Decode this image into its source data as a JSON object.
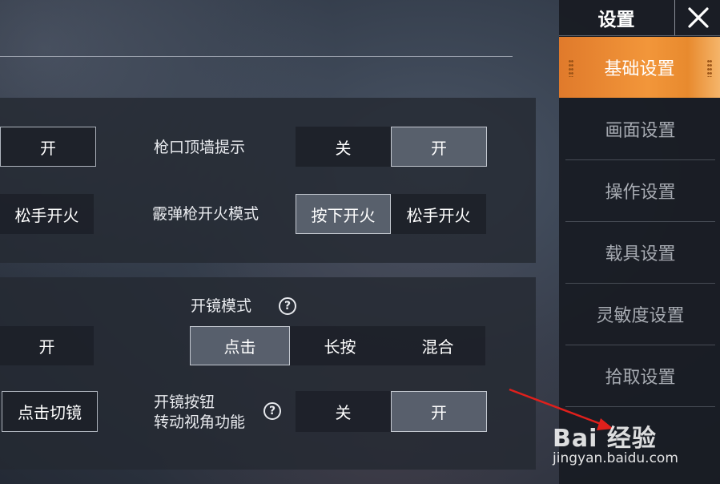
{
  "sidebar": {
    "title": "设置",
    "close_icon": "close-icon",
    "items": [
      {
        "label": "基础设置",
        "active": true
      },
      {
        "label": "画面设置"
      },
      {
        "label": "操作设置"
      },
      {
        "label": "载具设置"
      },
      {
        "label": "灵敏度设置"
      },
      {
        "label": "拾取设置"
      }
    ]
  },
  "section1": {
    "row1": {
      "left_option": "开",
      "label": "枪口顶墙提示",
      "options": [
        "关",
        "开"
      ],
      "selected": "开"
    },
    "row2": {
      "left_option": "松手开火",
      "label": "霰弹枪开火模式",
      "options": [
        "按下开火",
        "松手开火"
      ],
      "selected": "按下开火"
    }
  },
  "section2": {
    "scope_mode": {
      "label": "开镜模式",
      "help_icon": "question-icon",
      "left_option": "开",
      "options": [
        "点击",
        "长按",
        "混合"
      ],
      "selected": "点击"
    },
    "scope_button": {
      "left_option": "点击切镜",
      "label_line1": "开镜按钮",
      "label_line2": "转动视角功能",
      "help_icon": "question-icon",
      "options": [
        "关",
        "开"
      ],
      "selected": "开"
    }
  },
  "watermark": {
    "logo": "Bai 经验",
    "url": "jingyan.baidu.com",
    "arrow_color": "#e0201c"
  },
  "colors": {
    "accent": "#f0913a",
    "panel": "#242932"
  }
}
